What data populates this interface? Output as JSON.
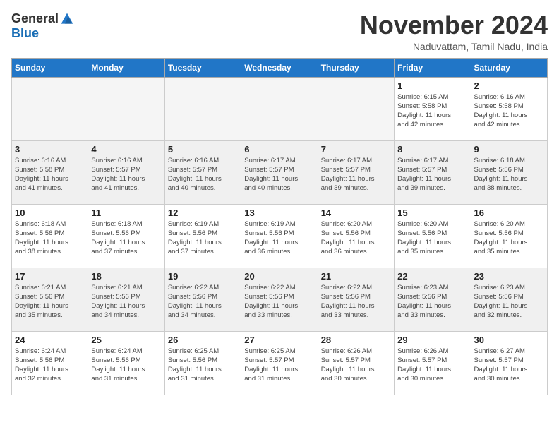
{
  "header": {
    "logo_general": "General",
    "logo_blue": "Blue",
    "month_title": "November 2024",
    "location": "Naduvattam, Tamil Nadu, India"
  },
  "weekdays": [
    "Sunday",
    "Monday",
    "Tuesday",
    "Wednesday",
    "Thursday",
    "Friday",
    "Saturday"
  ],
  "weeks": [
    [
      {
        "day": "",
        "info": ""
      },
      {
        "day": "",
        "info": ""
      },
      {
        "day": "",
        "info": ""
      },
      {
        "day": "",
        "info": ""
      },
      {
        "day": "",
        "info": ""
      },
      {
        "day": "1",
        "info": "Sunrise: 6:15 AM\nSunset: 5:58 PM\nDaylight: 11 hours\nand 42 minutes."
      },
      {
        "day": "2",
        "info": "Sunrise: 6:16 AM\nSunset: 5:58 PM\nDaylight: 11 hours\nand 42 minutes."
      }
    ],
    [
      {
        "day": "3",
        "info": "Sunrise: 6:16 AM\nSunset: 5:58 PM\nDaylight: 11 hours\nand 41 minutes."
      },
      {
        "day": "4",
        "info": "Sunrise: 6:16 AM\nSunset: 5:57 PM\nDaylight: 11 hours\nand 41 minutes."
      },
      {
        "day": "5",
        "info": "Sunrise: 6:16 AM\nSunset: 5:57 PM\nDaylight: 11 hours\nand 40 minutes."
      },
      {
        "day": "6",
        "info": "Sunrise: 6:17 AM\nSunset: 5:57 PM\nDaylight: 11 hours\nand 40 minutes."
      },
      {
        "day": "7",
        "info": "Sunrise: 6:17 AM\nSunset: 5:57 PM\nDaylight: 11 hours\nand 39 minutes."
      },
      {
        "day": "8",
        "info": "Sunrise: 6:17 AM\nSunset: 5:57 PM\nDaylight: 11 hours\nand 39 minutes."
      },
      {
        "day": "9",
        "info": "Sunrise: 6:18 AM\nSunset: 5:56 PM\nDaylight: 11 hours\nand 38 minutes."
      }
    ],
    [
      {
        "day": "10",
        "info": "Sunrise: 6:18 AM\nSunset: 5:56 PM\nDaylight: 11 hours\nand 38 minutes."
      },
      {
        "day": "11",
        "info": "Sunrise: 6:18 AM\nSunset: 5:56 PM\nDaylight: 11 hours\nand 37 minutes."
      },
      {
        "day": "12",
        "info": "Sunrise: 6:19 AM\nSunset: 5:56 PM\nDaylight: 11 hours\nand 37 minutes."
      },
      {
        "day": "13",
        "info": "Sunrise: 6:19 AM\nSunset: 5:56 PM\nDaylight: 11 hours\nand 36 minutes."
      },
      {
        "day": "14",
        "info": "Sunrise: 6:20 AM\nSunset: 5:56 PM\nDaylight: 11 hours\nand 36 minutes."
      },
      {
        "day": "15",
        "info": "Sunrise: 6:20 AM\nSunset: 5:56 PM\nDaylight: 11 hours\nand 35 minutes."
      },
      {
        "day": "16",
        "info": "Sunrise: 6:20 AM\nSunset: 5:56 PM\nDaylight: 11 hours\nand 35 minutes."
      }
    ],
    [
      {
        "day": "17",
        "info": "Sunrise: 6:21 AM\nSunset: 5:56 PM\nDaylight: 11 hours\nand 35 minutes."
      },
      {
        "day": "18",
        "info": "Sunrise: 6:21 AM\nSunset: 5:56 PM\nDaylight: 11 hours\nand 34 minutes."
      },
      {
        "day": "19",
        "info": "Sunrise: 6:22 AM\nSunset: 5:56 PM\nDaylight: 11 hours\nand 34 minutes."
      },
      {
        "day": "20",
        "info": "Sunrise: 6:22 AM\nSunset: 5:56 PM\nDaylight: 11 hours\nand 33 minutes."
      },
      {
        "day": "21",
        "info": "Sunrise: 6:22 AM\nSunset: 5:56 PM\nDaylight: 11 hours\nand 33 minutes."
      },
      {
        "day": "22",
        "info": "Sunrise: 6:23 AM\nSunset: 5:56 PM\nDaylight: 11 hours\nand 33 minutes."
      },
      {
        "day": "23",
        "info": "Sunrise: 6:23 AM\nSunset: 5:56 PM\nDaylight: 11 hours\nand 32 minutes."
      }
    ],
    [
      {
        "day": "24",
        "info": "Sunrise: 6:24 AM\nSunset: 5:56 PM\nDaylight: 11 hours\nand 32 minutes."
      },
      {
        "day": "25",
        "info": "Sunrise: 6:24 AM\nSunset: 5:56 PM\nDaylight: 11 hours\nand 31 minutes."
      },
      {
        "day": "26",
        "info": "Sunrise: 6:25 AM\nSunset: 5:56 PM\nDaylight: 11 hours\nand 31 minutes."
      },
      {
        "day": "27",
        "info": "Sunrise: 6:25 AM\nSunset: 5:57 PM\nDaylight: 11 hours\nand 31 minutes."
      },
      {
        "day": "28",
        "info": "Sunrise: 6:26 AM\nSunset: 5:57 PM\nDaylight: 11 hours\nand 30 minutes."
      },
      {
        "day": "29",
        "info": "Sunrise: 6:26 AM\nSunset: 5:57 PM\nDaylight: 11 hours\nand 30 minutes."
      },
      {
        "day": "30",
        "info": "Sunrise: 6:27 AM\nSunset: 5:57 PM\nDaylight: 11 hours\nand 30 minutes."
      }
    ]
  ]
}
